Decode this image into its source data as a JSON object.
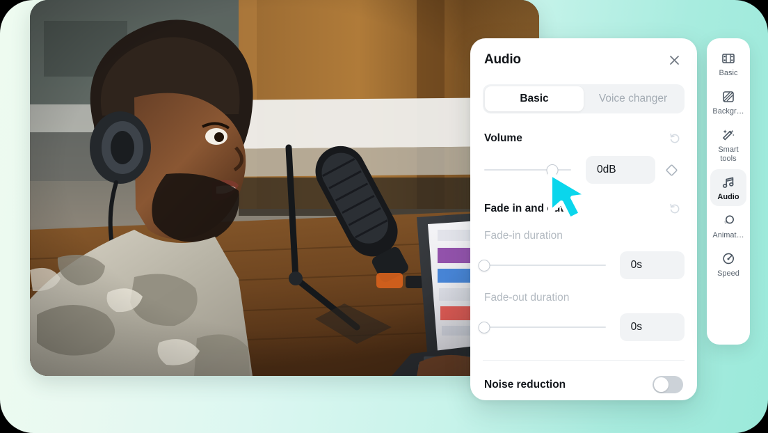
{
  "background": {
    "gradient_from": "#eefbf0",
    "gradient_to": "#9be9da"
  },
  "video": {
    "name": "podcast-host-with-headphones-and-microphone"
  },
  "panel": {
    "title": "Audio",
    "close_icon": "close-icon",
    "tabs": [
      {
        "label": "Basic",
        "active": true
      },
      {
        "label": "Voice changer",
        "active": false
      }
    ],
    "sections": [
      {
        "title": "Volume",
        "reset_icon": "reset-icon",
        "controls": [
          {
            "sub_label": "",
            "value": "0dB",
            "slider_percent": 78,
            "keyframe_icon": "keyframe-diamond-icon"
          }
        ]
      },
      {
        "title": "Fade in and out",
        "reset_icon": "reset-icon",
        "controls": [
          {
            "sub_label": "Fade-in duration",
            "value": "0s",
            "slider_percent": 0
          },
          {
            "sub_label": "Fade-out duration",
            "value": "0s",
            "slider_percent": 0
          }
        ]
      }
    ],
    "noise_reduction": {
      "label": "Noise reduction",
      "enabled": false
    }
  },
  "tool_rail": {
    "items": [
      {
        "label": "Basic",
        "icon": "film-strip-icon",
        "active": false
      },
      {
        "label": "Backgr…",
        "icon": "background-icon",
        "active": false
      },
      {
        "label": "Smart tools",
        "icon": "magic-wand-icon",
        "active": false
      },
      {
        "label": "Audio",
        "icon": "music-note-icon",
        "active": true
      },
      {
        "label": "Animat…",
        "icon": "animation-icon",
        "active": false
      },
      {
        "label": "Speed",
        "icon": "speedometer-icon",
        "active": false
      }
    ]
  },
  "cursor": {
    "icon": "arrow-pointer-cursor",
    "color": "#0ad6ec"
  }
}
